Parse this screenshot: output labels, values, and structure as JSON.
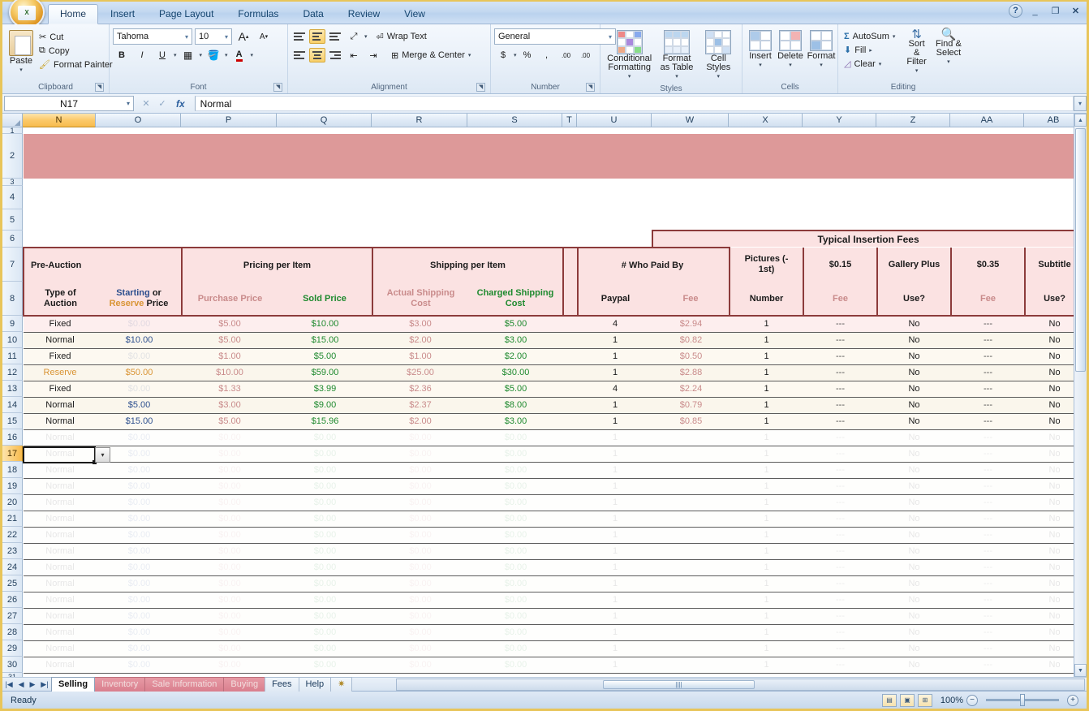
{
  "window": {
    "help_icon": "help-icon",
    "minimize_icon": "minimize-icon",
    "restore_icon": "restore-icon",
    "close_icon": "close-icon",
    "office_orb_label": "X"
  },
  "ribbon": {
    "tabs": [
      {
        "label": "Home",
        "active": true
      },
      {
        "label": "Insert",
        "active": false
      },
      {
        "label": "Page Layout",
        "active": false
      },
      {
        "label": "Formulas",
        "active": false
      },
      {
        "label": "Data",
        "active": false
      },
      {
        "label": "Review",
        "active": false
      },
      {
        "label": "View",
        "active": false
      }
    ],
    "clipboard": {
      "group_label": "Clipboard",
      "paste_label": "Paste",
      "cut_label": "Cut",
      "copy_label": "Copy",
      "format_painter_label": "Format Painter"
    },
    "font": {
      "group_label": "Font",
      "font_name": "Tahoma",
      "font_size": "10",
      "grow_label": "A",
      "shrink_label": "A",
      "bold_label": "B",
      "italic_label": "I",
      "underline_label": "U"
    },
    "alignment": {
      "group_label": "Alignment",
      "wrap_text_label": "Wrap Text",
      "merge_center_label": "Merge & Center"
    },
    "number": {
      "group_label": "Number",
      "format_value": "General",
      "currency_label": "$",
      "percent_label": "%",
      "comma_label": ",",
      "increase_decimal_label": ".00",
      "decrease_decimal_label": ".00"
    },
    "styles": {
      "group_label": "Styles",
      "conditional_formatting_label": "Conditional Formatting",
      "format_as_table_label": "Format as Table",
      "cell_styles_label": "Cell Styles"
    },
    "cells": {
      "group_label": "Cells",
      "insert_label": "Insert",
      "delete_label": "Delete",
      "format_label": "Format"
    },
    "editing": {
      "group_label": "Editing",
      "autosum_label": "AutoSum",
      "fill_label": "Fill",
      "clear_label": "Clear",
      "sort_filter_label": "Sort & Filter",
      "find_select_label": "Find & Select"
    }
  },
  "formula_bar": {
    "name_box": "N17",
    "formula_value": "Normal",
    "fx_label": "fx"
  },
  "grid": {
    "columns": [
      "N",
      "O",
      "P",
      "Q",
      "R",
      "S",
      "T",
      "U",
      "W",
      "X",
      "Y",
      "Z",
      "AA",
      "AB"
    ],
    "selected_column": "N",
    "selected_row": "17",
    "row_numbers": [
      "1",
      "2",
      "3",
      "4",
      "5",
      "6",
      "7",
      "8",
      "9",
      "10",
      "11",
      "12",
      "13",
      "14",
      "15",
      "16",
      "17",
      "18",
      "19",
      "20",
      "21",
      "22",
      "23",
      "24",
      "25",
      "26",
      "27",
      "28",
      "29",
      "30",
      "31"
    ],
    "section_headers": {
      "pre_auction": "Pre-Auction",
      "pricing_per_item": "Pricing per Item",
      "shipping_per_item": "Shipping per Item",
      "who_paid_by": "# Who Paid By",
      "typical_insertion_fees": "Typical Insertion Fees"
    },
    "sub_headers": {
      "type_of_auction": "Type of\nAuction",
      "type_of_auction_l1": "Type of",
      "type_of_auction_l2": "Auction",
      "starting_word": "Starting",
      "or_word": "or",
      "reserve_word": "Reserve",
      "price_word": "Price",
      "purchase_price": "Purchase Price",
      "sold_price": "Sold Price",
      "actual_shipping_cost_l1": "Actual Shipping",
      "actual_shipping_cost_l2": "Cost",
      "charged_shipping_cost_l1": "Charged Shipping",
      "charged_shipping_cost_l2": "Cost",
      "paypal": "Paypal",
      "fee": "Fee",
      "pictures_l1": "Pictures (-",
      "pictures_l2": "1st)",
      "number": "Number",
      "price_015": "$0.15",
      "fee_015": "Fee",
      "gallery_plus": "Gallery Plus",
      "use_gallery": "Use?",
      "price_035": "$0.35",
      "fee_035": "Fee",
      "subtitle": "Subtitle",
      "use_subtitle": "Use?"
    },
    "rows": [
      {
        "row": "9",
        "type": "Fixed",
        "starting": "$0.00",
        "purchase": "$5.00",
        "sold": "$10.00",
        "actual_ship": "$3.00",
        "charged_ship": "$5.00",
        "paypal": "4",
        "fee": "$2.94",
        "pictures": "1",
        "fee015": "---",
        "gallery": "No",
        "fee035": "---",
        "subtitle": "No",
        "starting_faint": true
      },
      {
        "row": "10",
        "type": "Normal",
        "starting": "$10.00",
        "purchase": "$5.00",
        "sold": "$15.00",
        "actual_ship": "$2.00",
        "charged_ship": "$3.00",
        "paypal": "1",
        "fee": "$0.82",
        "pictures": "1",
        "fee015": "---",
        "gallery": "No",
        "fee035": "---",
        "subtitle": "No",
        "starting_faint": false
      },
      {
        "row": "11",
        "type": "Fixed",
        "starting": "$0.00",
        "purchase": "$1.00",
        "sold": "$5.00",
        "actual_ship": "$1.00",
        "charged_ship": "$2.00",
        "paypal": "1",
        "fee": "$0.50",
        "pictures": "1",
        "fee015": "---",
        "gallery": "No",
        "fee035": "---",
        "subtitle": "No",
        "starting_faint": true
      },
      {
        "row": "12",
        "type": "Reserve",
        "starting": "$50.00",
        "purchase": "$10.00",
        "sold": "$59.00",
        "actual_ship": "$25.00",
        "charged_ship": "$30.00",
        "paypal": "1",
        "fee": "$2.88",
        "pictures": "1",
        "fee015": "---",
        "gallery": "No",
        "fee035": "---",
        "subtitle": "No",
        "starting_faint": false
      },
      {
        "row": "13",
        "type": "Fixed",
        "starting": "$0.00",
        "purchase": "$1.33",
        "sold": "$3.99",
        "actual_ship": "$2.36",
        "charged_ship": "$5.00",
        "paypal": "4",
        "fee": "$2.24",
        "pictures": "1",
        "fee015": "---",
        "gallery": "No",
        "fee035": "---",
        "subtitle": "No",
        "starting_faint": true
      },
      {
        "row": "14",
        "type": "Normal",
        "starting": "$5.00",
        "purchase": "$3.00",
        "sold": "$9.00",
        "actual_ship": "$2.37",
        "charged_ship": "$8.00",
        "paypal": "1",
        "fee": "$0.79",
        "pictures": "1",
        "fee015": "---",
        "gallery": "No",
        "fee035": "---",
        "subtitle": "No",
        "starting_faint": false
      },
      {
        "row": "15",
        "type": "Normal",
        "starting": "$15.00",
        "purchase": "$5.00",
        "sold": "$15.96",
        "actual_ship": "$2.00",
        "charged_ship": "$3.00",
        "paypal": "1",
        "fee": "$0.85",
        "pictures": "1",
        "fee015": "---",
        "gallery": "No",
        "fee035": "---",
        "subtitle": "No",
        "starting_faint": false
      }
    ],
    "empty_rows": [
      {
        "row": "16",
        "type": "Normal",
        "starting": "$0.00",
        "purchase": "$0.00",
        "sold": "$0.00",
        "actual_ship": "$0.00",
        "charged_ship": "$0.00",
        "paypal": "1",
        "fee": "",
        "pictures": "1",
        "fee015": "---",
        "gallery": "No",
        "fee035": "---",
        "subtitle": "No"
      },
      {
        "row": "17",
        "type": "Normal",
        "starting": "$0.00",
        "purchase": "$0.00",
        "sold": "$0.00",
        "actual_ship": "$0.00",
        "charged_ship": "$0.00",
        "paypal": "1",
        "fee": "",
        "pictures": "1",
        "fee015": "---",
        "gallery": "No",
        "fee035": "---",
        "subtitle": "No"
      },
      {
        "row": "18",
        "type": "Normal",
        "starting": "$0.00",
        "purchase": "$0.00",
        "sold": "$0.00",
        "actual_ship": "$0.00",
        "charged_ship": "$0.00",
        "paypal": "1",
        "fee": "",
        "pictures": "1",
        "fee015": "---",
        "gallery": "No",
        "fee035": "---",
        "subtitle": "No"
      },
      {
        "row": "19",
        "type": "Normal",
        "starting": "$0.00",
        "purchase": "$0.00",
        "sold": "$0.00",
        "actual_ship": "$0.00",
        "charged_ship": "$0.00",
        "paypal": "1",
        "fee": "",
        "pictures": "1",
        "fee015": "---",
        "gallery": "No",
        "fee035": "---",
        "subtitle": "No"
      },
      {
        "row": "20",
        "type": "Normal",
        "starting": "$0.00",
        "purchase": "$0.00",
        "sold": "$0.00",
        "actual_ship": "$0.00",
        "charged_ship": "$0.00",
        "paypal": "1",
        "fee": "",
        "pictures": "1",
        "fee015": "---",
        "gallery": "No",
        "fee035": "---",
        "subtitle": "No"
      },
      {
        "row": "21",
        "type": "Normal",
        "starting": "$0.00",
        "purchase": "$0.00",
        "sold": "$0.00",
        "actual_ship": "$0.00",
        "charged_ship": "$0.00",
        "paypal": "1",
        "fee": "",
        "pictures": "1",
        "fee015": "---",
        "gallery": "No",
        "fee035": "---",
        "subtitle": "No"
      },
      {
        "row": "22",
        "type": "Normal",
        "starting": "$0.00",
        "purchase": "$0.00",
        "sold": "$0.00",
        "actual_ship": "$0.00",
        "charged_ship": "$0.00",
        "paypal": "1",
        "fee": "",
        "pictures": "1",
        "fee015": "---",
        "gallery": "No",
        "fee035": "---",
        "subtitle": "No"
      },
      {
        "row": "23",
        "type": "Normal",
        "starting": "$0.00",
        "purchase": "$0.00",
        "sold": "$0.00",
        "actual_ship": "$0.00",
        "charged_ship": "$0.00",
        "paypal": "1",
        "fee": "",
        "pictures": "1",
        "fee015": "---",
        "gallery": "No",
        "fee035": "---",
        "subtitle": "No"
      },
      {
        "row": "24",
        "type": "Normal",
        "starting": "$0.00",
        "purchase": "$0.00",
        "sold": "$0.00",
        "actual_ship": "$0.00",
        "charged_ship": "$0.00",
        "paypal": "1",
        "fee": "",
        "pictures": "1",
        "fee015": "---",
        "gallery": "No",
        "fee035": "---",
        "subtitle": "No"
      },
      {
        "row": "25",
        "type": "Normal",
        "starting": "$0.00",
        "purchase": "$0.00",
        "sold": "$0.00",
        "actual_ship": "$0.00",
        "charged_ship": "$0.00",
        "paypal": "1",
        "fee": "",
        "pictures": "1",
        "fee015": "---",
        "gallery": "No",
        "fee035": "---",
        "subtitle": "No"
      },
      {
        "row": "26",
        "type": "Normal",
        "starting": "$0.00",
        "purchase": "$0.00",
        "sold": "$0.00",
        "actual_ship": "$0.00",
        "charged_ship": "$0.00",
        "paypal": "1",
        "fee": "",
        "pictures": "1",
        "fee015": "---",
        "gallery": "No",
        "fee035": "---",
        "subtitle": "No"
      },
      {
        "row": "27",
        "type": "Normal",
        "starting": "$0.00",
        "purchase": "$0.00",
        "sold": "$0.00",
        "actual_ship": "$0.00",
        "charged_ship": "$0.00",
        "paypal": "1",
        "fee": "",
        "pictures": "1",
        "fee015": "---",
        "gallery": "No",
        "fee035": "---",
        "subtitle": "No"
      },
      {
        "row": "28",
        "type": "Normal",
        "starting": "$0.00",
        "purchase": "$0.00",
        "sold": "$0.00",
        "actual_ship": "$0.00",
        "charged_ship": "$0.00",
        "paypal": "1",
        "fee": "",
        "pictures": "1",
        "fee015": "---",
        "gallery": "No",
        "fee035": "---",
        "subtitle": "No"
      },
      {
        "row": "29",
        "type": "Normal",
        "starting": "$0.00",
        "purchase": "$0.00",
        "sold": "$0.00",
        "actual_ship": "$0.00",
        "charged_ship": "$0.00",
        "paypal": "1",
        "fee": "",
        "pictures": "1",
        "fee015": "---",
        "gallery": "No",
        "fee035": "---",
        "subtitle": "No"
      },
      {
        "row": "30",
        "type": "Normal",
        "starting": "$0.00",
        "purchase": "$0.00",
        "sold": "$0.00",
        "actual_ship": "$0.00",
        "charged_ship": "$0.00",
        "paypal": "1",
        "fee": "",
        "pictures": "1",
        "fee015": "---",
        "gallery": "No",
        "fee035": "---",
        "subtitle": "No"
      }
    ]
  },
  "sheet_tabs": [
    {
      "label": "Selling",
      "style": "active"
    },
    {
      "label": "Inventory",
      "style": "pink"
    },
    {
      "label": "Sale Information",
      "style": "pink"
    },
    {
      "label": "Buying",
      "style": "pink"
    },
    {
      "label": "Fees",
      "style": "plain"
    },
    {
      "label": "Help",
      "style": "plain"
    }
  ],
  "status_bar": {
    "status_text": "Ready",
    "zoom_level": "100%",
    "zoom_out_label": "−",
    "zoom_in_label": "+",
    "view_normal_icon": "normal-view-icon",
    "view_layout_icon": "page-layout-view-icon",
    "view_break_icon": "page-break-view-icon"
  },
  "colors": {
    "accent_band": "#dd9999",
    "header_fill": "#fbe2e2",
    "header_border": "#8c3b3b",
    "green": "#1f8a2f",
    "blue": "#2d4f8e",
    "orange": "#d99434",
    "rose": "#c98b8b"
  }
}
